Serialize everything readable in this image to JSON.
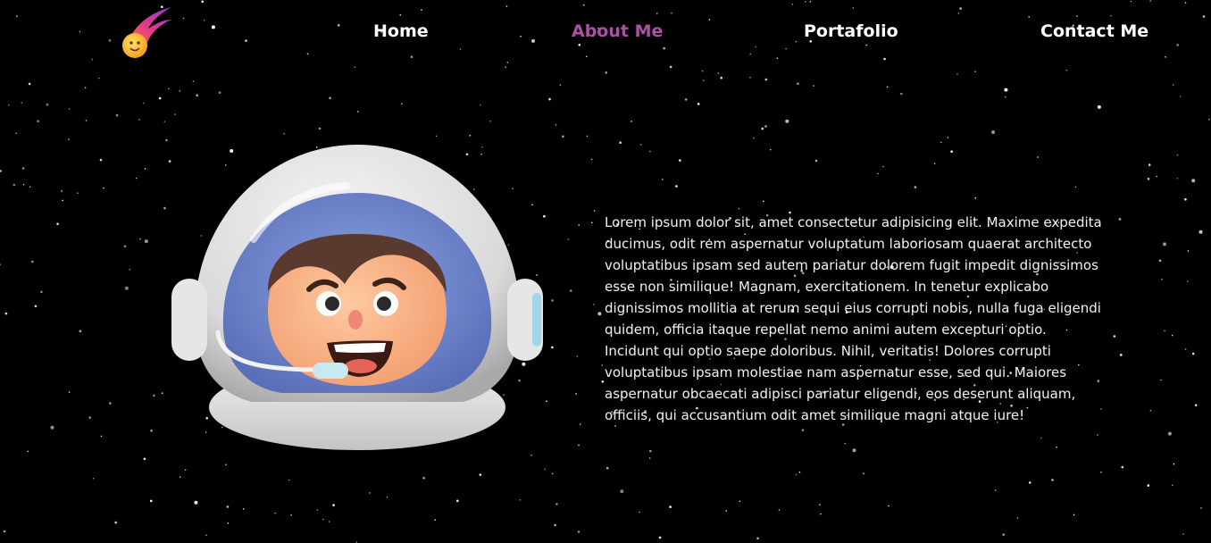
{
  "nav": {
    "items": [
      {
        "label": "Home",
        "active": false
      },
      {
        "label": "About Me",
        "active": true
      },
      {
        "label": "Portafolio",
        "active": false
      },
      {
        "label": "Contact Me",
        "active": false
      }
    ],
    "active_color": "#b04fa8"
  },
  "logo": {
    "icon": "comet-icon"
  },
  "hero": {
    "image": "astronaut-helmet-illustration"
  },
  "about": {
    "text": "Lorem ipsum dolor sit, amet consectetur adipisicing elit. Maxime expedita ducimus, odit rem aspernatur voluptatum laboriosam quaerat architecto voluptatibus ipsam sed autem pariatur dolorem fugit impedit dignissimos esse non similique! Magnam, exercitationem. In tenetur explicabo dignissimos mollitia at rerum sequi eius corrupti nobis, nulla fuga eligendi quidem, officia itaque repellat nemo animi autem excepturi optio. Incidunt qui optio saepe doloribus. Nihil, veritatis! Dolores corrupti voluptatibus ipsam molestiae nam aspernatur esse, sed qui. Maiores aspernatur obcaecati adipisci pariatur eligendi, eos deserunt aliquam, officiis, qui accusantium odit amet similique magni atque iure!"
  },
  "colors": {
    "background": "#000000",
    "text": "#ffffff"
  }
}
